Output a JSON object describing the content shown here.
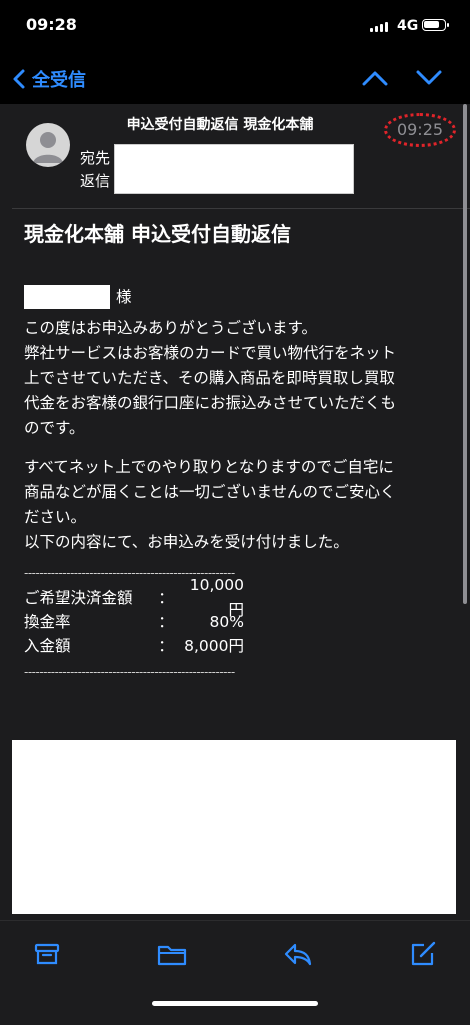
{
  "status": {
    "time": "09:28",
    "network": "4G"
  },
  "nav": {
    "back_label": "全受信"
  },
  "header": {
    "sender": "申込受付自動返信 現金化本舗",
    "to_label": "宛先",
    "reply_label": "返信",
    "time": "09:25"
  },
  "subject": "現金化本舗 申込受付自動返信",
  "body": {
    "honorific": "様",
    "p1": [
      "この度はお申込みありがとうございます。",
      "弊社サービスはお客様のカードで買い物代行をネット",
      "上でさせていただき、その購入商品を即時買取し買取",
      "代金をお客様の銀行口座にお振込みさせていただくも",
      "のです。"
    ],
    "p2": [
      "すべてネット上でのやり取りとなりますのでご自宅に",
      "商品などが届くことは一切ございませんのでご安心く",
      "ださい。",
      "以下の内容にて、お申込みを受け付けました。"
    ],
    "dashes": "-------------------------------------------------------",
    "rows": [
      {
        "key": "ご希望決済金額",
        "colon": "：",
        "value": "10,000円"
      },
      {
        "key": "換金率",
        "colon": "：",
        "value": "80%"
      },
      {
        "key": "入金額",
        "colon": "：",
        "value": "8,000円"
      }
    ]
  },
  "icons": {
    "back": "chevron-left-icon",
    "up": "chevron-up-icon",
    "down": "chevron-down-icon",
    "archive": "archive-icon",
    "folder": "folder-icon",
    "reply": "reply-icon",
    "compose": "compose-icon"
  },
  "colors": {
    "accent": "#2f8cff",
    "background": "#1c1c1e",
    "highlight": "#e0242a"
  }
}
